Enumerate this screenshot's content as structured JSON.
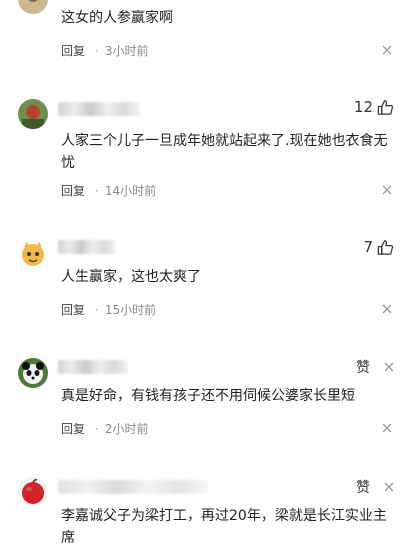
{
  "comments": [
    {
      "text": "这女的人参赢家啊",
      "reply": "回复",
      "dot": "·",
      "time": "3小时前"
    },
    {
      "likes": "12",
      "text": "人家三个儿子一旦成年她就站起来了.现在她也衣食无忧",
      "reply": "回复",
      "dot": "·",
      "time": "14小时前"
    },
    {
      "likes": "7",
      "text": "人生赢家，这也太爽了",
      "reply": "回复",
      "dot": "·",
      "time": "15小时前"
    },
    {
      "likes": "赞",
      "text": "真是好命，有钱有孩子还不用伺候公婆家长里短",
      "reply": "回复",
      "dot": "·",
      "time": "2小时前"
    },
    {
      "likes": "赞",
      "text": "李嘉诚父子为梁打工，再过20年，梁就是长江实业主席"
    }
  ],
  "icons": {
    "like": "thumbs-up-icon",
    "close": "close-icon"
  }
}
